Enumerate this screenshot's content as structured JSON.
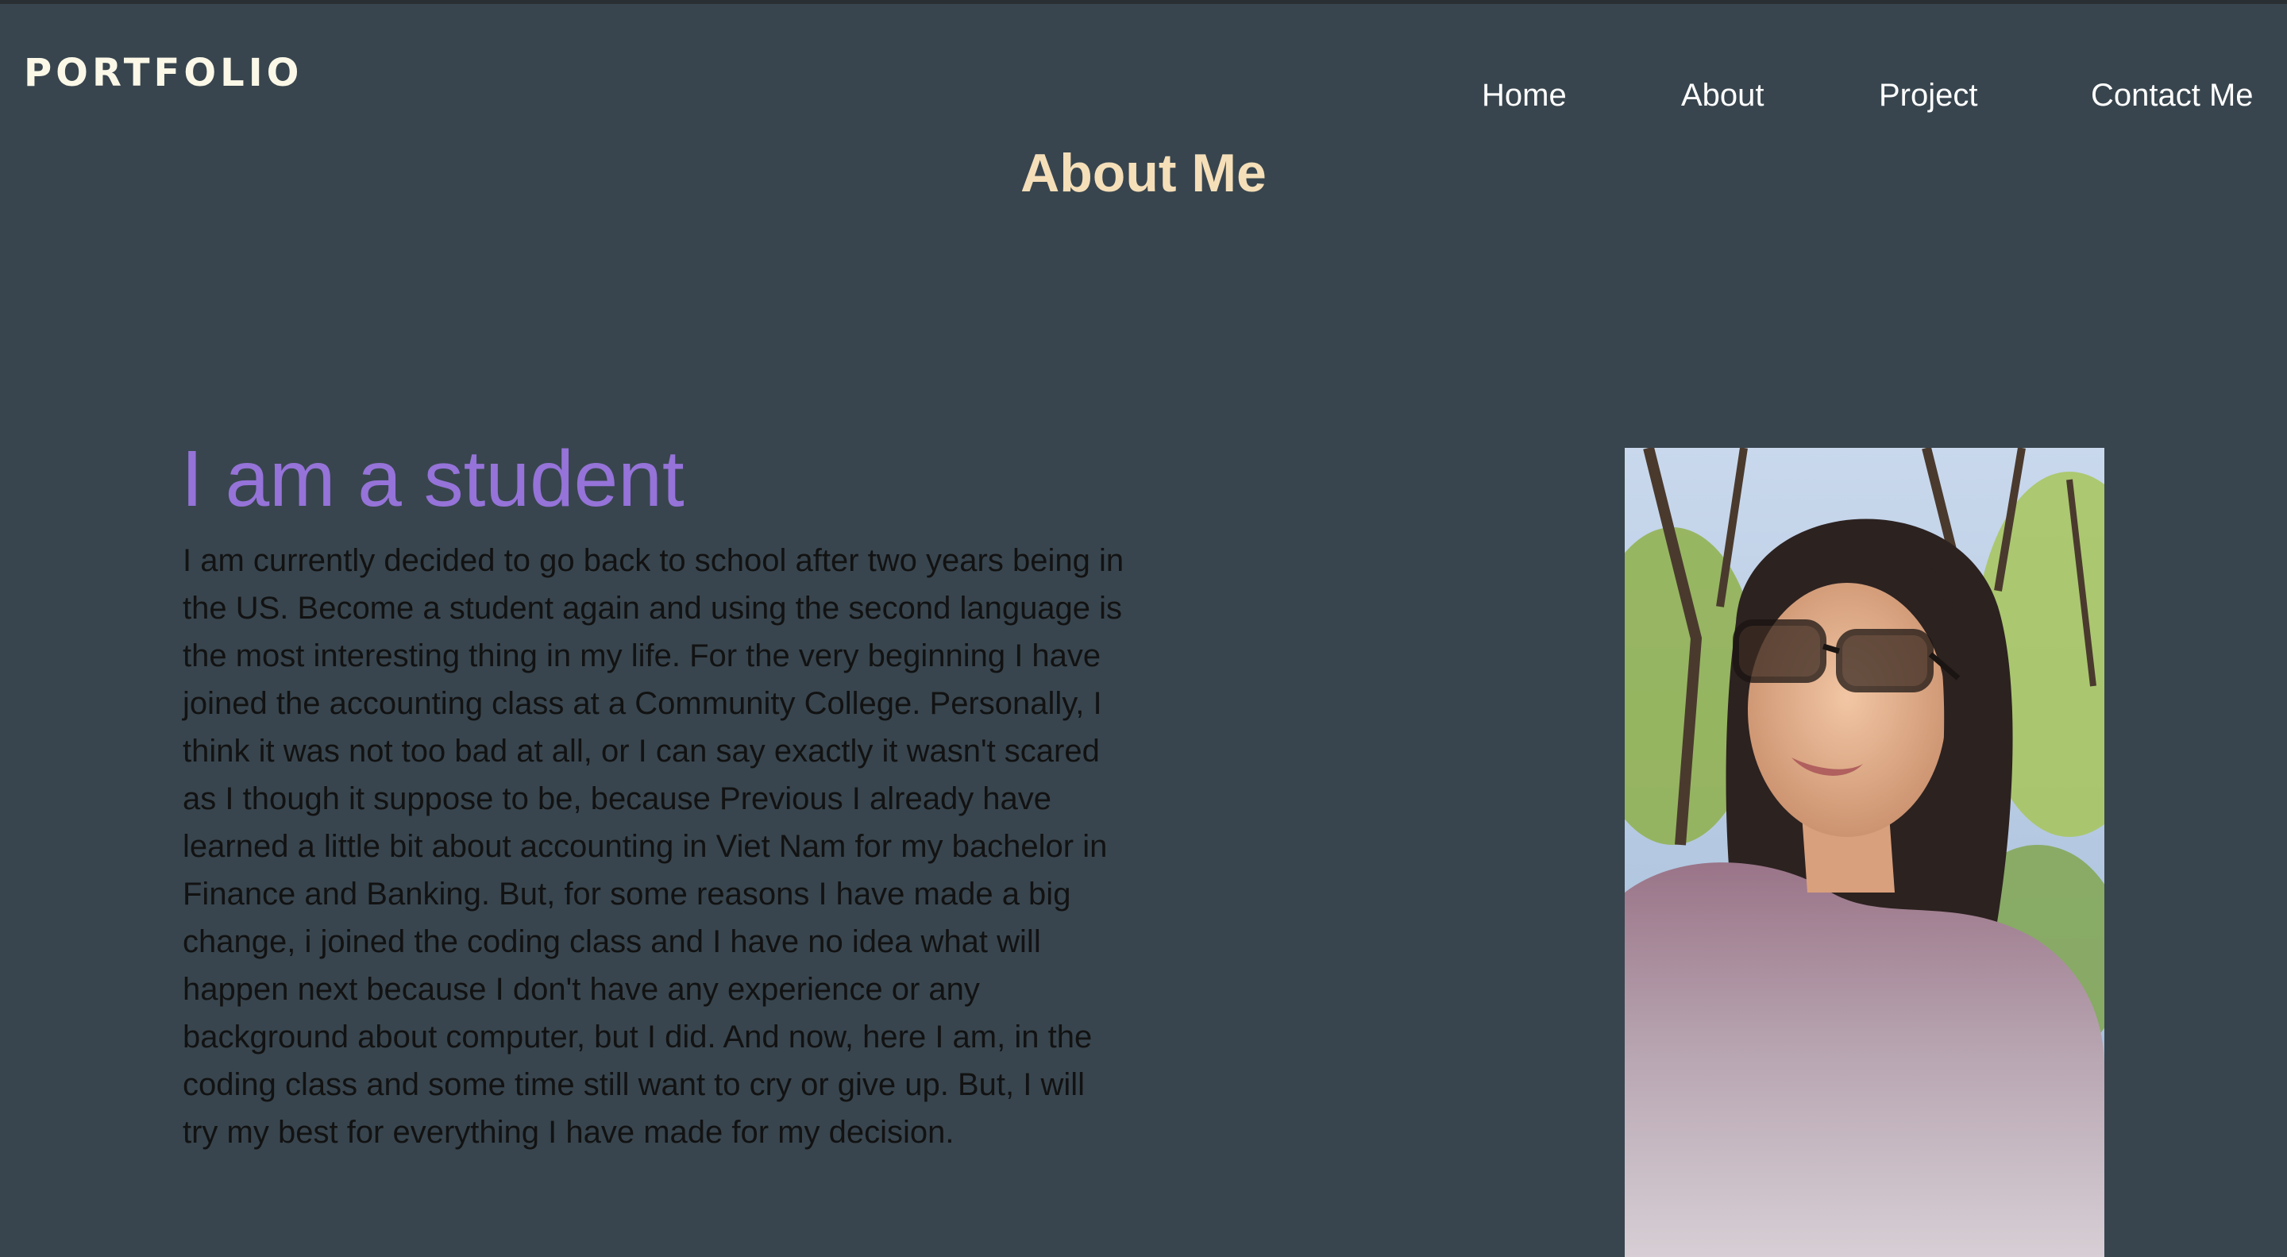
{
  "header": {
    "brand": "PORTFOLIO",
    "nav": [
      {
        "label": "Home"
      },
      {
        "label": "About"
      },
      {
        "label": "Project"
      },
      {
        "label": "Contact Me"
      }
    ]
  },
  "main": {
    "title": "About Me",
    "heading": "I am a student",
    "bio": "I am currently decided to go back to school after two years being in the US. Become a student again and using the second language is the most interesting thing in my life. For the very beginning I have joined the accounting class at a Community College. Personally, I think it was not too bad at all, or I can say exactly it wasn't scared as I though it suppose to be, because Previous I already have learned a little bit about accounting in Viet Nam for my bachelor in Finance and Banking. But, for some reasons I have made a big change, i joined the coding class and I have no idea what will happen next because I don't have any experience or any background about computer, but I did. And now, here I am, in the coding class and some time still want to cry or give up. But, I will try my best for everything I have made for my decision.",
    "photo_icon": "profile-photo"
  },
  "colors": {
    "background": "#38454e",
    "title": "#f5dfb9",
    "heading": "#9573d8",
    "brand": "#fbf8e8"
  }
}
